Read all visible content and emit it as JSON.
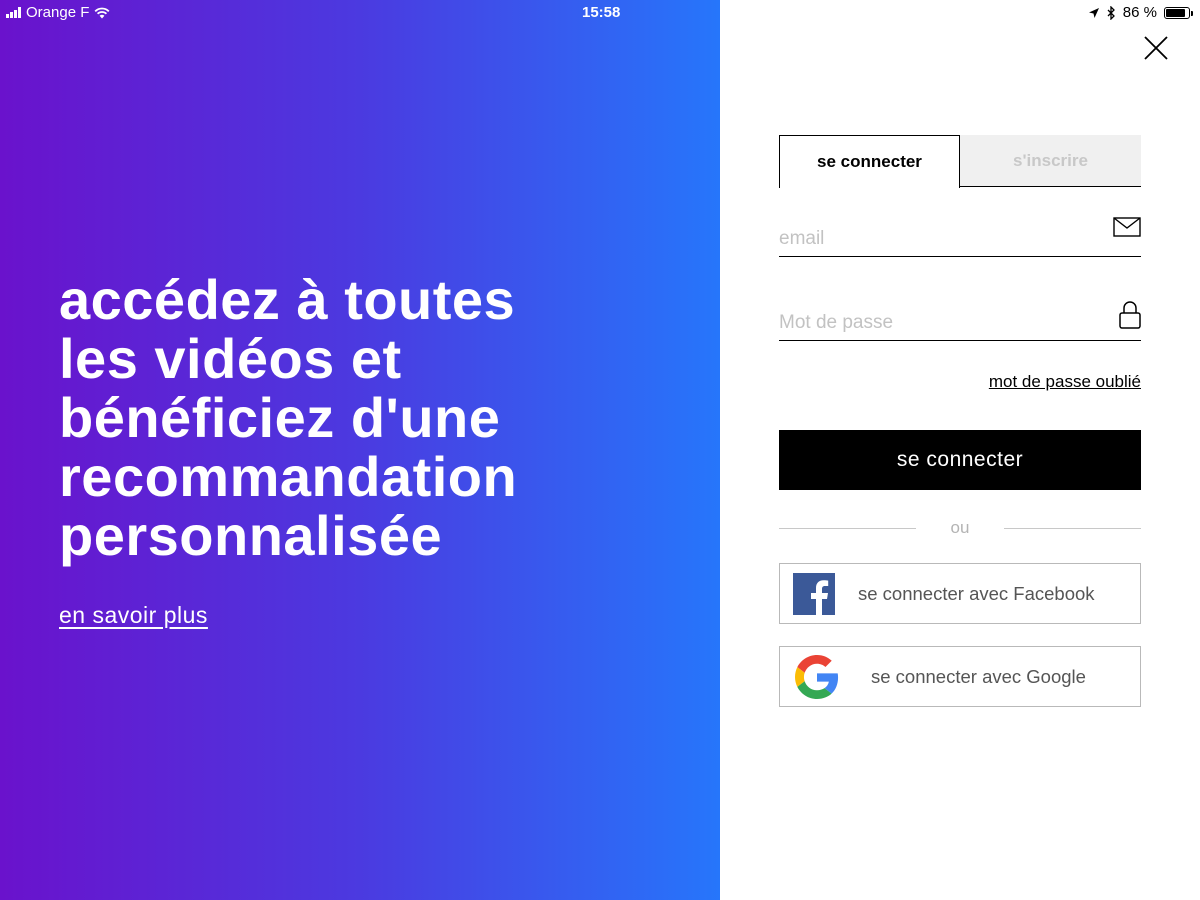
{
  "status_bar": {
    "carrier": "Orange F",
    "time": "15:58",
    "battery": "86 %",
    "battery_level": 0.86
  },
  "promo": {
    "headline": "accédez à toutes\nles vidéos et\nbénéficiez d'une\nrecommandation\npersonnalisée",
    "learn_more": "en savoir plus",
    "gradient_colors": [
      "#6a12cc",
      "#2676fb"
    ]
  },
  "tabs": {
    "login": "se connecter",
    "signup": "s'inscrire",
    "active": "login"
  },
  "form": {
    "email_placeholder": "email",
    "email_value": "",
    "password_placeholder": "Mot de passe",
    "password_value": "",
    "forgot_password": "mot de passe oublié",
    "submit": "se connecter",
    "or": "ou",
    "facebook": "se connecter avec Facebook",
    "google": "se connecter avec Google"
  },
  "icons": {
    "close": "close-icon",
    "email": "envelope-icon",
    "password": "lock-icon",
    "facebook": "facebook-logo",
    "google": "google-logo"
  },
  "colors": {
    "primary_button": "#000000",
    "facebook": "#3b5998"
  }
}
